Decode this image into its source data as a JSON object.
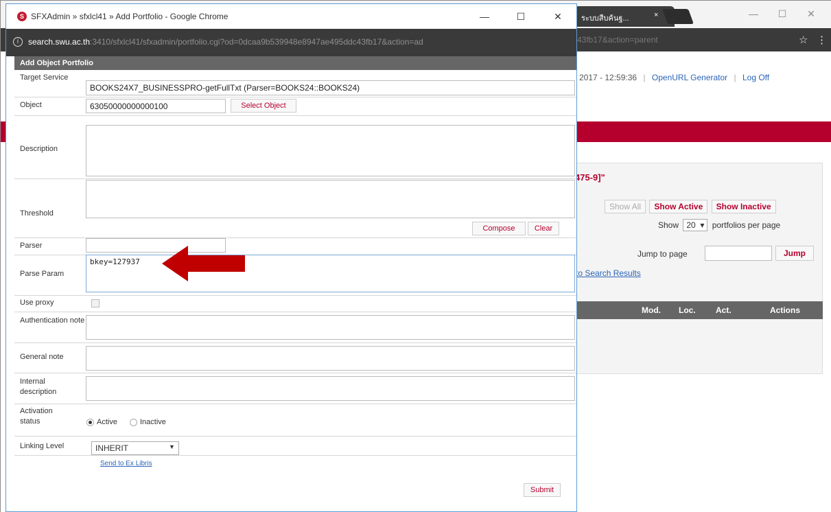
{
  "background_window": {
    "tab_title": "ระบบสืบค้นฐ...",
    "tab_close": "×",
    "controls": [
      "—",
      "☐",
      "✕"
    ],
    "url_tail": "43fb17&action=parent",
    "top_nav": {
      "timestamp": "2017 - 12:59:36",
      "link1": "OpenURL Generator",
      "link2": "Log Off",
      "separator": "|"
    },
    "heading_fragment": "475-9]\"",
    "filters": {
      "all": "Show All",
      "active": "Show Active",
      "inactive": "Show Inactive"
    },
    "per_page": {
      "prefix": "Show",
      "value": "20",
      "suffix": "portfolios per page"
    },
    "jump": {
      "label": "Jump to page",
      "button": "Jump"
    },
    "back_link": "to Search Results",
    "columns": [
      "Mod.",
      "Loc.",
      "Act.",
      "Actions"
    ]
  },
  "popup_window": {
    "title": "SFXAdmin » sfxlcl41 » Add Portfolio - Google Chrome",
    "controls": [
      "—",
      "☐",
      "✕"
    ],
    "url_host": "search.swu.ac.th",
    "url_path": ":3410/sfxlcl41/sfxadmin/portfolio.cgi?od=0dcaa9b539948e8947ae495ddc43fb17&action=ad",
    "form": {
      "header": "Add Object Portfolio",
      "target_service": {
        "label": "Target Service",
        "value": "BOOKS24X7_BUSINESSPRO-getFullTxt (Parser=BOOKS24::BOOKS24)"
      },
      "object": {
        "label": "Object",
        "value": "63050000000000100",
        "button": "Select Object"
      },
      "description": {
        "label": "Description",
        "value": ""
      },
      "threshold": {
        "label": "Threshold",
        "value": "",
        "compose": "Compose",
        "clear": "Clear"
      },
      "parser": {
        "label": "Parser",
        "value": ""
      },
      "parse_param": {
        "label": "Parse Param",
        "value": "bkey=127937"
      },
      "use_proxy": {
        "label": "Use proxy",
        "checked": false
      },
      "authentication_note": {
        "label": "Authentication note",
        "value": ""
      },
      "general_note": {
        "label": "General note",
        "value": ""
      },
      "internal_description": {
        "label": "Internal description",
        "value": ""
      },
      "activation_status": {
        "label": "Activation status",
        "options": [
          "Active",
          "Inactive"
        ],
        "selected": "Active"
      },
      "linking_level": {
        "label": "Linking Level",
        "value": "INHERIT"
      },
      "send_link": "Send to Ex Libris",
      "submit": "Submit"
    }
  },
  "colors": {
    "accent": "#b5002e",
    "link": "#2a63b8",
    "header_gray": "#666666",
    "arrow": "#c00000"
  }
}
